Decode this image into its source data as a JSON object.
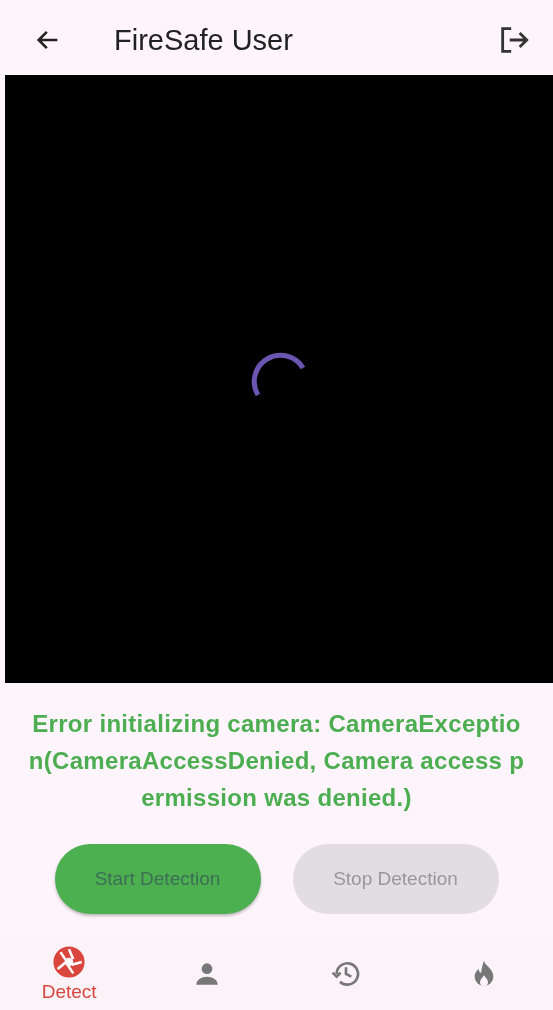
{
  "app_bar": {
    "title": "FireSafe User"
  },
  "camera": {
    "loading": true
  },
  "error_message": "Error initializing camera: CameraException(CameraAccessDenied, Camera access permission was denied.)",
  "buttons": [
    {
      "label": "Start Detection",
      "disabled": false
    },
    {
      "label": "Stop Detection",
      "disabled": true
    }
  ],
  "nav": [
    {
      "kind": "detect",
      "label": "Detect",
      "selected": true
    },
    {
      "kind": "profile",
      "selected": false
    },
    {
      "kind": "history",
      "selected": false
    },
    {
      "kind": "fire",
      "selected": false
    }
  ]
}
